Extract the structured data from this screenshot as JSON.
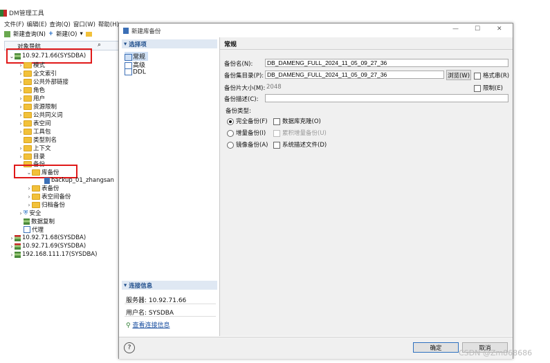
{
  "app": {
    "title": "DM管理工具",
    "menu": [
      "文件(F)",
      "编辑(E)",
      "查询(Q)",
      "窗口(W)",
      "帮助(H)"
    ],
    "toolbar": {
      "new_query": "新建查询(N)",
      "new": "新建(O)"
    }
  },
  "tree": {
    "panel_title": "对象导航",
    "root": "10.92.71.66(SYSDBA)",
    "items": [
      "模式",
      "全文索引",
      "公共外部链接",
      "角色",
      "用户",
      "资源限制",
      "公共同义词",
      "表空间",
      "工具包",
      "类型别名",
      "上下文",
      "目录",
      "备份"
    ],
    "backup_children": {
      "library_backup": "库备份",
      "backup_item": "backup_01_zhangsan",
      "others": [
        "表备份",
        "表空间备份",
        "归档备份"
      ]
    },
    "after": [
      "安全",
      "数据复制",
      "代理"
    ],
    "connections": [
      "10.92.71.68(SYSDBA)",
      "10.92.71.69(SYSDBA)",
      "192.168.111.17(SYSDBA)"
    ]
  },
  "dialog": {
    "title": "新建库备份",
    "window_controls": {
      "minimize": "—",
      "maximize": "☐",
      "close": "✕"
    },
    "nav_header": "选择项",
    "nav_items": [
      "常规",
      "高级",
      "DDL"
    ],
    "conn_header": "连接信息",
    "conn": {
      "server": "服务器: 10.92.71.66",
      "user": "用户名: SYSDBA",
      "view_link": "查看连接信息"
    },
    "section_title": "常规",
    "form": {
      "name_label": "备份名(N):",
      "name_value": "DB_DAMENG_FULL_2024_11_05_09_27_36",
      "dir_label": "备份集目录(P):",
      "dir_value": "DB_DAMENG_FULL_2024_11_05_09_27_36",
      "browse": "浏览(W)",
      "format_string": "格式串(R)",
      "piece_label": "备份片大小(M):",
      "piece_value": "2048",
      "limit": "限制(E)",
      "desc_label": "备份描述(C):",
      "desc_value": "",
      "type_label": "备份类型:",
      "full": "完全备份(F)",
      "incremental": "增量备份(I)",
      "mirror": "镜像备份(A)",
      "clone": "数据库克隆(O)",
      "cumulative": "累积增量备份(U)",
      "sysdesc": "系统描述文件(D)"
    },
    "help": "?",
    "ok": "确定",
    "cancel": "取消"
  },
  "watermark": "CSDN @Zm868686"
}
